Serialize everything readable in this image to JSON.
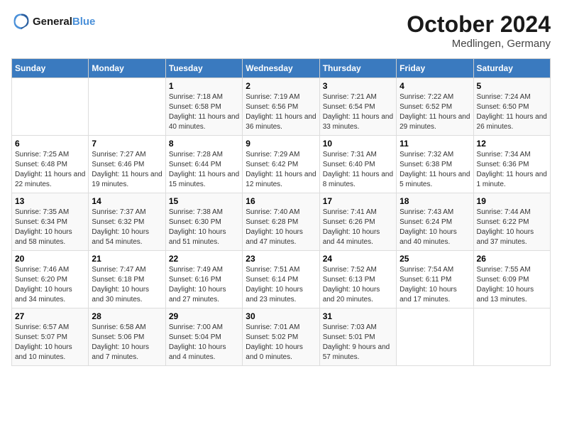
{
  "header": {
    "logo_line1": "General",
    "logo_line2": "Blue",
    "month_title": "October 2024",
    "location": "Medlingen, Germany"
  },
  "weekdays": [
    "Sunday",
    "Monday",
    "Tuesday",
    "Wednesday",
    "Thursday",
    "Friday",
    "Saturday"
  ],
  "weeks": [
    [
      {
        "day": "",
        "sunrise": "",
        "sunset": "",
        "daylight": ""
      },
      {
        "day": "",
        "sunrise": "",
        "sunset": "",
        "daylight": ""
      },
      {
        "day": "1",
        "sunrise": "Sunrise: 7:18 AM",
        "sunset": "Sunset: 6:58 PM",
        "daylight": "Daylight: 11 hours and 40 minutes."
      },
      {
        "day": "2",
        "sunrise": "Sunrise: 7:19 AM",
        "sunset": "Sunset: 6:56 PM",
        "daylight": "Daylight: 11 hours and 36 minutes."
      },
      {
        "day": "3",
        "sunrise": "Sunrise: 7:21 AM",
        "sunset": "Sunset: 6:54 PM",
        "daylight": "Daylight: 11 hours and 33 minutes."
      },
      {
        "day": "4",
        "sunrise": "Sunrise: 7:22 AM",
        "sunset": "Sunset: 6:52 PM",
        "daylight": "Daylight: 11 hours and 29 minutes."
      },
      {
        "day": "5",
        "sunrise": "Sunrise: 7:24 AM",
        "sunset": "Sunset: 6:50 PM",
        "daylight": "Daylight: 11 hours and 26 minutes."
      }
    ],
    [
      {
        "day": "6",
        "sunrise": "Sunrise: 7:25 AM",
        "sunset": "Sunset: 6:48 PM",
        "daylight": "Daylight: 11 hours and 22 minutes."
      },
      {
        "day": "7",
        "sunrise": "Sunrise: 7:27 AM",
        "sunset": "Sunset: 6:46 PM",
        "daylight": "Daylight: 11 hours and 19 minutes."
      },
      {
        "day": "8",
        "sunrise": "Sunrise: 7:28 AM",
        "sunset": "Sunset: 6:44 PM",
        "daylight": "Daylight: 11 hours and 15 minutes."
      },
      {
        "day": "9",
        "sunrise": "Sunrise: 7:29 AM",
        "sunset": "Sunset: 6:42 PM",
        "daylight": "Daylight: 11 hours and 12 minutes."
      },
      {
        "day": "10",
        "sunrise": "Sunrise: 7:31 AM",
        "sunset": "Sunset: 6:40 PM",
        "daylight": "Daylight: 11 hours and 8 minutes."
      },
      {
        "day": "11",
        "sunrise": "Sunrise: 7:32 AM",
        "sunset": "Sunset: 6:38 PM",
        "daylight": "Daylight: 11 hours and 5 minutes."
      },
      {
        "day": "12",
        "sunrise": "Sunrise: 7:34 AM",
        "sunset": "Sunset: 6:36 PM",
        "daylight": "Daylight: 11 hours and 1 minute."
      }
    ],
    [
      {
        "day": "13",
        "sunrise": "Sunrise: 7:35 AM",
        "sunset": "Sunset: 6:34 PM",
        "daylight": "Daylight: 10 hours and 58 minutes."
      },
      {
        "day": "14",
        "sunrise": "Sunrise: 7:37 AM",
        "sunset": "Sunset: 6:32 PM",
        "daylight": "Daylight: 10 hours and 54 minutes."
      },
      {
        "day": "15",
        "sunrise": "Sunrise: 7:38 AM",
        "sunset": "Sunset: 6:30 PM",
        "daylight": "Daylight: 10 hours and 51 minutes."
      },
      {
        "day": "16",
        "sunrise": "Sunrise: 7:40 AM",
        "sunset": "Sunset: 6:28 PM",
        "daylight": "Daylight: 10 hours and 47 minutes."
      },
      {
        "day": "17",
        "sunrise": "Sunrise: 7:41 AM",
        "sunset": "Sunset: 6:26 PM",
        "daylight": "Daylight: 10 hours and 44 minutes."
      },
      {
        "day": "18",
        "sunrise": "Sunrise: 7:43 AM",
        "sunset": "Sunset: 6:24 PM",
        "daylight": "Daylight: 10 hours and 40 minutes."
      },
      {
        "day": "19",
        "sunrise": "Sunrise: 7:44 AM",
        "sunset": "Sunset: 6:22 PM",
        "daylight": "Daylight: 10 hours and 37 minutes."
      }
    ],
    [
      {
        "day": "20",
        "sunrise": "Sunrise: 7:46 AM",
        "sunset": "Sunset: 6:20 PM",
        "daylight": "Daylight: 10 hours and 34 minutes."
      },
      {
        "day": "21",
        "sunrise": "Sunrise: 7:47 AM",
        "sunset": "Sunset: 6:18 PM",
        "daylight": "Daylight: 10 hours and 30 minutes."
      },
      {
        "day": "22",
        "sunrise": "Sunrise: 7:49 AM",
        "sunset": "Sunset: 6:16 PM",
        "daylight": "Daylight: 10 hours and 27 minutes."
      },
      {
        "day": "23",
        "sunrise": "Sunrise: 7:51 AM",
        "sunset": "Sunset: 6:14 PM",
        "daylight": "Daylight: 10 hours and 23 minutes."
      },
      {
        "day": "24",
        "sunrise": "Sunrise: 7:52 AM",
        "sunset": "Sunset: 6:13 PM",
        "daylight": "Daylight: 10 hours and 20 minutes."
      },
      {
        "day": "25",
        "sunrise": "Sunrise: 7:54 AM",
        "sunset": "Sunset: 6:11 PM",
        "daylight": "Daylight: 10 hours and 17 minutes."
      },
      {
        "day": "26",
        "sunrise": "Sunrise: 7:55 AM",
        "sunset": "Sunset: 6:09 PM",
        "daylight": "Daylight: 10 hours and 13 minutes."
      }
    ],
    [
      {
        "day": "27",
        "sunrise": "Sunrise: 6:57 AM",
        "sunset": "Sunset: 5:07 PM",
        "daylight": "Daylight: 10 hours and 10 minutes."
      },
      {
        "day": "28",
        "sunrise": "Sunrise: 6:58 AM",
        "sunset": "Sunset: 5:06 PM",
        "daylight": "Daylight: 10 hours and 7 minutes."
      },
      {
        "day": "29",
        "sunrise": "Sunrise: 7:00 AM",
        "sunset": "Sunset: 5:04 PM",
        "daylight": "Daylight: 10 hours and 4 minutes."
      },
      {
        "day": "30",
        "sunrise": "Sunrise: 7:01 AM",
        "sunset": "Sunset: 5:02 PM",
        "daylight": "Daylight: 10 hours and 0 minutes."
      },
      {
        "day": "31",
        "sunrise": "Sunrise: 7:03 AM",
        "sunset": "Sunset: 5:01 PM",
        "daylight": "Daylight: 9 hours and 57 minutes."
      },
      {
        "day": "",
        "sunrise": "",
        "sunset": "",
        "daylight": ""
      },
      {
        "day": "",
        "sunrise": "",
        "sunset": "",
        "daylight": ""
      }
    ]
  ]
}
